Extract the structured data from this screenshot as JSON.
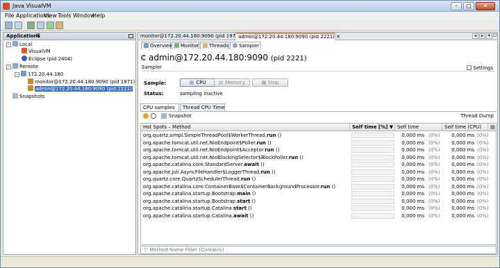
{
  "window": {
    "title": "Java VisualVM"
  },
  "menubar": {
    "items": [
      "File",
      "Applications",
      "View",
      "Tools",
      "Window",
      "Help"
    ]
  },
  "left_panel": {
    "title": "Applications",
    "tree": [
      {
        "label": "Local",
        "level": 0
      },
      {
        "label": "VisualVM",
        "level": 1
      },
      {
        "label": "Eclipse (pid 2404)",
        "level": 1
      },
      {
        "label": "Remote",
        "level": 0
      },
      {
        "label": "172.20.44.180",
        "level": 1
      },
      {
        "label": "monitor@172.20.44.180:9090 (pid 1971)",
        "level": 2
      },
      {
        "label": "admin@172.20.44.180:9090 (pid 2221)",
        "level": 2,
        "selected": true
      },
      {
        "label": "Snapshots",
        "level": 0
      }
    ]
  },
  "doc_tabs": [
    {
      "label": "monitor@172.20.44.180:9090 (pid 1971)"
    },
    {
      "label": "admin@172.20.44.180:9090 (pid 2221)",
      "active": true
    }
  ],
  "subtabs": [
    "Overview",
    "Monitor",
    "Threads",
    "Sampler"
  ],
  "main": {
    "title": "admin@172.20.44.180:9090",
    "title_pid": "(pid 2221)",
    "section": "Sampler",
    "settings_label": "Settings",
    "sample_label": "Sample:",
    "buttons": {
      "cpu": "CPU",
      "memory": "Memory",
      "stop": "Stop"
    },
    "status_label": "Status:",
    "status_value": "sampling inactive"
  },
  "profile_tabs": [
    "CPU samples",
    "Thread CPU Time"
  ],
  "toolbar": {
    "snapshot_label": "Snapshot",
    "thread_dump_label": "Thread Dump"
  },
  "table": {
    "columns": [
      "Hot Spots – Method",
      "Self time [%] ▼",
      "Self time",
      "Self time (CPU)"
    ],
    "rows": [
      {
        "m1": "org.quartz.simpl.SimpleThreadPool$WorkerThread.",
        "m2": "run",
        "m3": " ()",
        "time": "0,000 ms",
        "pct": "(0%)",
        "cpu": "0,000 ms",
        "cpupct": "(0%)"
      },
      {
        "m1": "org.apache.tomcat.util.net.NioEndpoint$Poller.",
        "m2": "run",
        "m3": " ()",
        "time": "0,000 ms",
        "pct": "(0%)",
        "cpu": "0,000 ms",
        "cpupct": "(0%)"
      },
      {
        "m1": "org.apache.tomcat.util.net.NioEndpoint$Acceptor.",
        "m2": "run",
        "m3": " ()",
        "time": "0,000 ms",
        "pct": "(0%)",
        "cpu": "0,000 ms",
        "cpupct": "(0%)"
      },
      {
        "m1": "org.apache.tomcat.util.net.NioBlockingSelector$BlockPoller.",
        "m2": "run",
        "m3": " ()",
        "time": "0,000 ms",
        "pct": "(0%)",
        "cpu": "0,000 ms",
        "cpupct": "(0%)"
      },
      {
        "m1": "org.apache.catalina.core.StandardServer.",
        "m2": "await",
        "m3": " ()",
        "time": "0,000 ms",
        "pct": "(0%)",
        "cpu": "0,000 ms",
        "cpupct": "(0%)"
      },
      {
        "m1": "org.apache.juli.AsyncFileHandler$LoggerThread.",
        "m2": "run",
        "m3": " ()",
        "time": "0,000 ms",
        "pct": "(0%)",
        "cpu": "0,000 ms",
        "cpupct": "(0%)"
      },
      {
        "m1": "org.quartz.core.QuartzSchedulerThread.",
        "m2": "run",
        "m3": " ()",
        "time": "0,000 ms",
        "pct": "(0%)",
        "cpu": "0,000 ms",
        "cpupct": "(0%)"
      },
      {
        "m1": "org.apache.catalina.core.ContainerBase$ContainerBackgroundProcessor.",
        "m2": "run",
        "m3": " ()",
        "time": "0,000 ms",
        "pct": "(0%)",
        "cpu": "0,000 ms",
        "cpupct": "(0%)"
      },
      {
        "m1": "org.apache.catalina.startup.Bootstrap.",
        "m2": "main",
        "m3": " ()",
        "time": "0,000 ms",
        "pct": "(0%)",
        "cpu": "0,000 ms",
        "cpupct": "(0%)"
      },
      {
        "m1": "org.apache.catalina.startup.Bootstrap.",
        "m2": "start",
        "m3": " ()",
        "time": "0,000 ms",
        "pct": "(0%)",
        "cpu": "0,000 ms",
        "cpupct": "(0%)"
      },
      {
        "m1": "org.apache.catalina.startup.Catalina.",
        "m2": "start",
        "m3": " ()",
        "time": "0,000 ms",
        "pct": "(0%)",
        "cpu": "0,000 ms",
        "cpupct": "(0%)"
      },
      {
        "m1": "org.apache.catalina.startup.Catalina.",
        "m2": "await",
        "m3": " ()",
        "time": "0,000 ms",
        "pct": "(0%)",
        "cpu": "0,000 ms",
        "cpupct": "(0%)"
      }
    ]
  },
  "filter": {
    "placeholder": "Method Name Filter (Contains)"
  },
  "colors": {
    "accent": "#3d6eb8",
    "tab_active": "#f39c20"
  }
}
